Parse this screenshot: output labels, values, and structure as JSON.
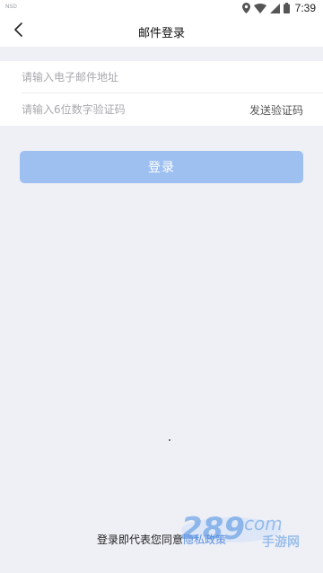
{
  "status_bar": {
    "carrier_text": "NSD",
    "time": "7:39",
    "icons": [
      "location-icon",
      "wifi-icon",
      "signal-icon",
      "battery-icon"
    ]
  },
  "nav": {
    "back_icon": "chevron-left-icon",
    "title": "邮件登录"
  },
  "form": {
    "email_placeholder": "请输入电子邮件地址",
    "email_value": "",
    "code_placeholder": "请输入6位数字验证码",
    "code_value": "",
    "send_code_label": "发送验证码"
  },
  "login_button": {
    "label": "登录",
    "color": "#9ec0f1"
  },
  "agreement": {
    "prefix": "登录即代表您同意",
    "link_label": "隐私政策"
  },
  "watermark": {
    "text": "289.com",
    "subtext": "手游网"
  },
  "colors": {
    "background": "#eff0f6",
    "link": "#5b8fe0"
  }
}
